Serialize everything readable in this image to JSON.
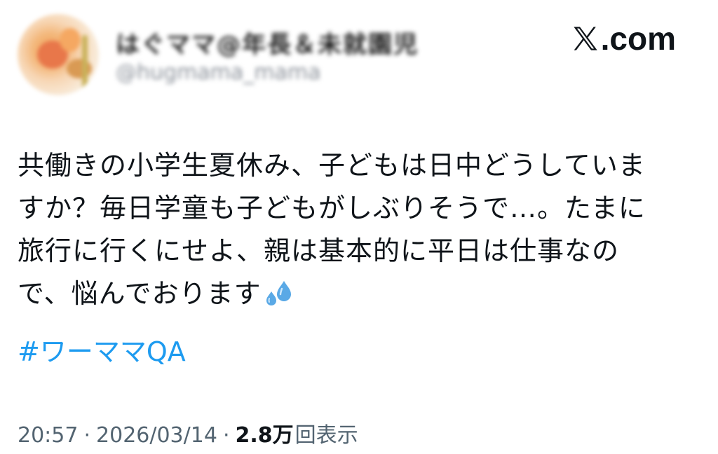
{
  "header": {
    "display_name": "はぐママ@年長＆未就園児",
    "handle": "@hugmama_mama",
    "brand": ".com",
    "brand_icon": "x-logo-icon"
  },
  "tweet": {
    "lines": [
      "共働きの小学生夏休み、子どもは日中どうしていま",
      "すか？毎日学童も子どもがしぶりそうで…。たまに",
      "旅行に行くにせよ、親は基本的に平日は仕事なの",
      "で、悩んでおります"
    ],
    "emoji": "sweat-droplets-icon",
    "hashtag": "#ワーママQA"
  },
  "meta": {
    "time": "20:57",
    "separator": "·",
    "date": "2026/03/14",
    "views_count": "2.8万",
    "views_label": "回表示"
  },
  "colors": {
    "link": "#1d9bf0",
    "text": "#0f1419",
    "muted": "#536471"
  }
}
